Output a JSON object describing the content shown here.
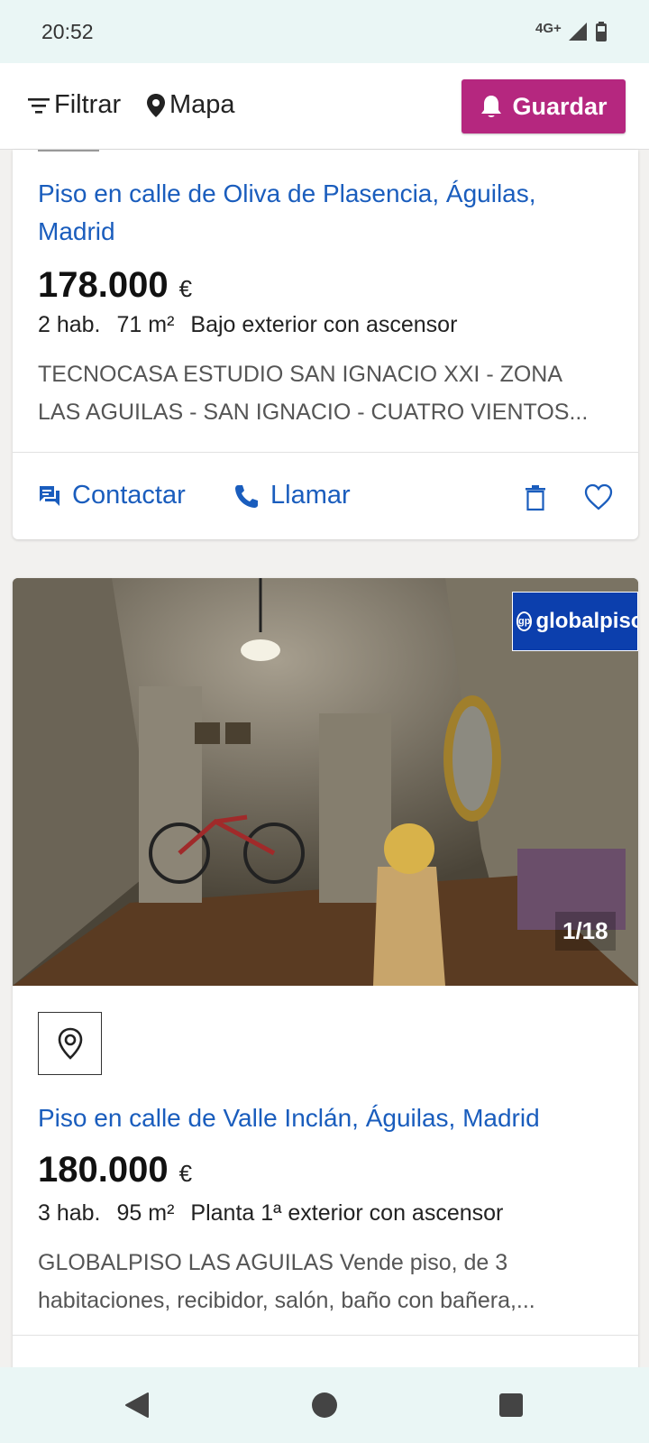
{
  "status_bar": {
    "time": "20:52",
    "network": "4G+"
  },
  "toolbar": {
    "filter_label": "Filtrar",
    "map_label": "Mapa",
    "save_label": "Guardar"
  },
  "listings": [
    {
      "title_line1": "Piso en calle de Oliva de Plasencia, Águilas,",
      "title_line2": "Madrid",
      "price": "178.000",
      "currency": "€",
      "rooms": "2 hab.",
      "area": "71 m²",
      "floor": "Bajo exterior con ascensor",
      "desc_line1": "TECNOCASA ESTUDIO SAN IGNACIO XXI - ZONA",
      "desc_line2": "LAS AGUILAS - SAN IGNACIO - CUATRO VIENTOS...",
      "contact_label": "Contactar",
      "call_label": "Llamar"
    },
    {
      "agency": "globalpiso",
      "agency_badge": "gp",
      "photo_counter": "1/18",
      "title_line1": "Piso en calle de Valle Inclán, Águilas, Madrid",
      "price": "180.000",
      "currency": "€",
      "rooms": "3 hab.",
      "area": "95 m²",
      "floor": "Planta 1ª exterior con ascensor",
      "desc_line1": "GLOBALPISO LAS AGUILAS Vende piso, de 3",
      "desc_line2": "habitaciones, recibidor, salón, baño con bañera,..."
    }
  ],
  "colors": {
    "link_blue": "#1a5dbd",
    "save_magenta": "#b5277f",
    "agency_blue": "#0c3fad"
  }
}
